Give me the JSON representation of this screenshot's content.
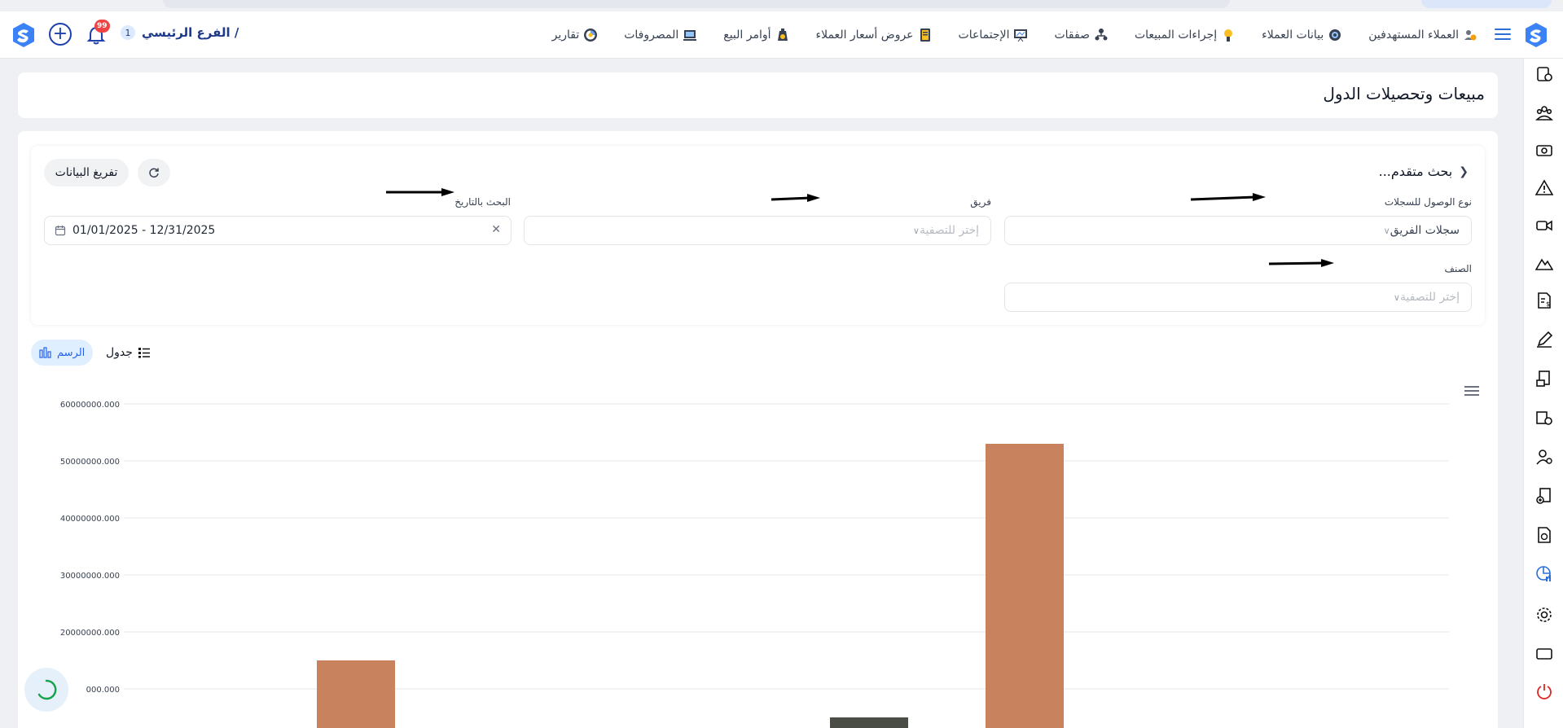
{
  "topbar": {
    "branch_count": "1",
    "branch_name": "الفرع الرئيسي /",
    "notification_count": "99",
    "nav_items": [
      {
        "label": "العملاء المستهدفين",
        "icon": "users-target-icon"
      },
      {
        "label": "بيانات العملاء",
        "icon": "customer-data-icon"
      },
      {
        "label": "إجراءات المبيعات",
        "icon": "sales-actions-icon"
      },
      {
        "label": "صفقات",
        "icon": "deals-icon"
      },
      {
        "label": "الإجتماعات",
        "icon": "meetings-icon"
      },
      {
        "label": "عروض أسعار العملاء",
        "icon": "quotes-icon"
      },
      {
        "label": "أوامر البيع",
        "icon": "sales-orders-icon"
      },
      {
        "label": "المصروفات",
        "icon": "expenses-icon"
      },
      {
        "label": "تقارير",
        "icon": "reports-icon"
      }
    ]
  },
  "page": {
    "title": "مبيعات وتحصيلات الدول"
  },
  "filters": {
    "advanced_search_label": "بحث متقدم...",
    "export_label": "تفريغ البيانات",
    "access_type_label": "نوع الوصول للسجلات",
    "access_type_value": "سجلات الفريق",
    "team_label": "فريق",
    "team_placeholder": "إختر للتصفية",
    "date_label": "البحث بالتاريخ",
    "date_value": "01/01/2025 - 12/31/2025",
    "category_label": "الصنف",
    "category_placeholder": "إختر للتصفية"
  },
  "view": {
    "chart_label": "الرسم",
    "table_label": "جدول"
  },
  "colors": {
    "accent": "#2b6ed6",
    "bar_orange": "#c8825e",
    "bar_dark": "#4a4d45"
  },
  "chart_data": {
    "type": "bar",
    "y_ticks": [
      "60000000.000",
      "50000000.000",
      "40000000.000",
      "30000000.000",
      "20000000.000",
      "000.000"
    ],
    "ylim": [
      0,
      60000000
    ],
    "series": [
      {
        "values": [
          15000000,
          53000000
        ]
      },
      {
        "values": [
          5000000
        ]
      }
    ]
  }
}
